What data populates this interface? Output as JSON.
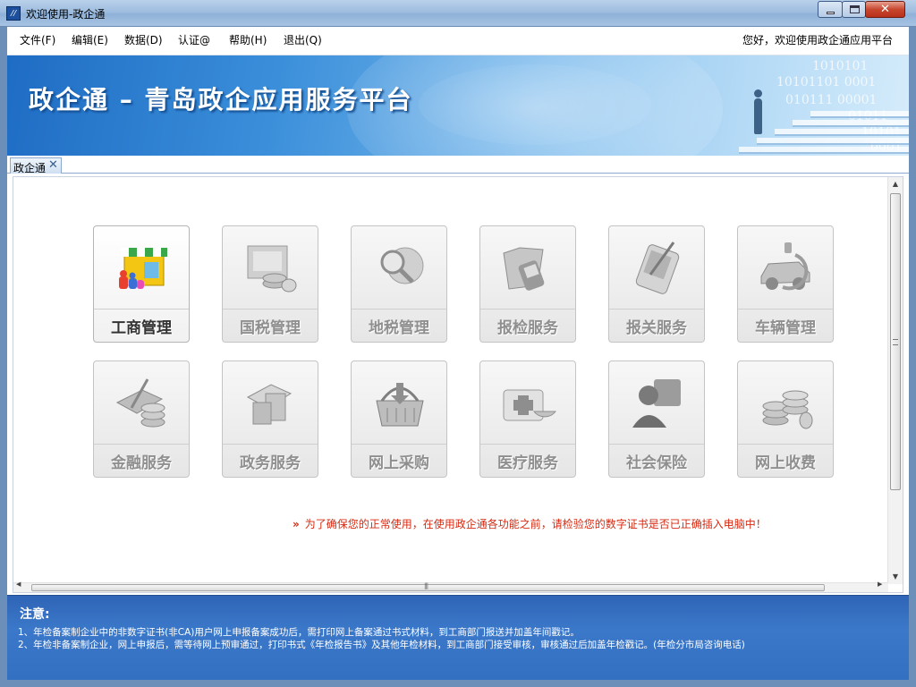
{
  "window": {
    "title": "欢迎使用-政企通",
    "close_glyph": "✕"
  },
  "menu": {
    "items": [
      "文件(F)",
      "编辑(E)",
      "数据(D)",
      "认证@",
      "帮助(H)",
      "退出(Q)"
    ],
    "greeting": "您好，欢迎使用政企通应用平台"
  },
  "banner": {
    "title": "政企通 – 青岛政企应用服务平台",
    "binary_rows": [
      "1010101",
      "10101101 0001",
      "010111 00001",
      "01011",
      "10101",
      "0001"
    ]
  },
  "tab": {
    "label": "政企通",
    "close": "✕"
  },
  "tiles": [
    {
      "label": "工商管理",
      "icon": "storefront-icon",
      "active": true
    },
    {
      "label": "国税管理",
      "icon": "tax-coins-icon",
      "active": false
    },
    {
      "label": "地税管理",
      "icon": "magnifier-globe-icon",
      "active": false
    },
    {
      "label": "报检服务",
      "icon": "folder-pda-icon",
      "active": false
    },
    {
      "label": "报关服务",
      "icon": "pda-pen-icon",
      "active": false
    },
    {
      "label": "车辆管理",
      "icon": "car-icon",
      "active": false
    },
    {
      "label": "金融服务",
      "icon": "bank-card-coins-icon",
      "active": false
    },
    {
      "label": "政务服务",
      "icon": "documents-icon",
      "active": false
    },
    {
      "label": "网上采购",
      "icon": "shopping-basket-icon",
      "active": false
    },
    {
      "label": "医疗服务",
      "icon": "medical-kit-icon",
      "active": false
    },
    {
      "label": "社会保险",
      "icon": "person-id-icon",
      "active": false
    },
    {
      "label": "网上收费",
      "icon": "coin-stacks-icon",
      "active": false
    }
  ],
  "notice": {
    "mark": "»",
    "text": "为了确保您的正常使用，在使用政企通各功能之前，请检验您的数字证书是否已正确插入电脑中！"
  },
  "footer": {
    "title": "注意:",
    "lines": [
      "1、年检备案制企业中的非数字证书(非CA)用户网上申报备案成功后，需打印网上备案通过书式材料，到工商部门报送并加盖年间戳记。",
      "2、年检非备案制企业，网上申报后，需等待网上预审通过，打印书式《年检报告书》及其他年检材料，到工商部门接受审核，审核通过后加盖年检戳记。(年检分市局咨询电话)"
    ]
  },
  "colors": {
    "notice": "#d62a12",
    "banner": "#3b8fda",
    "footer": "#3470c2"
  }
}
